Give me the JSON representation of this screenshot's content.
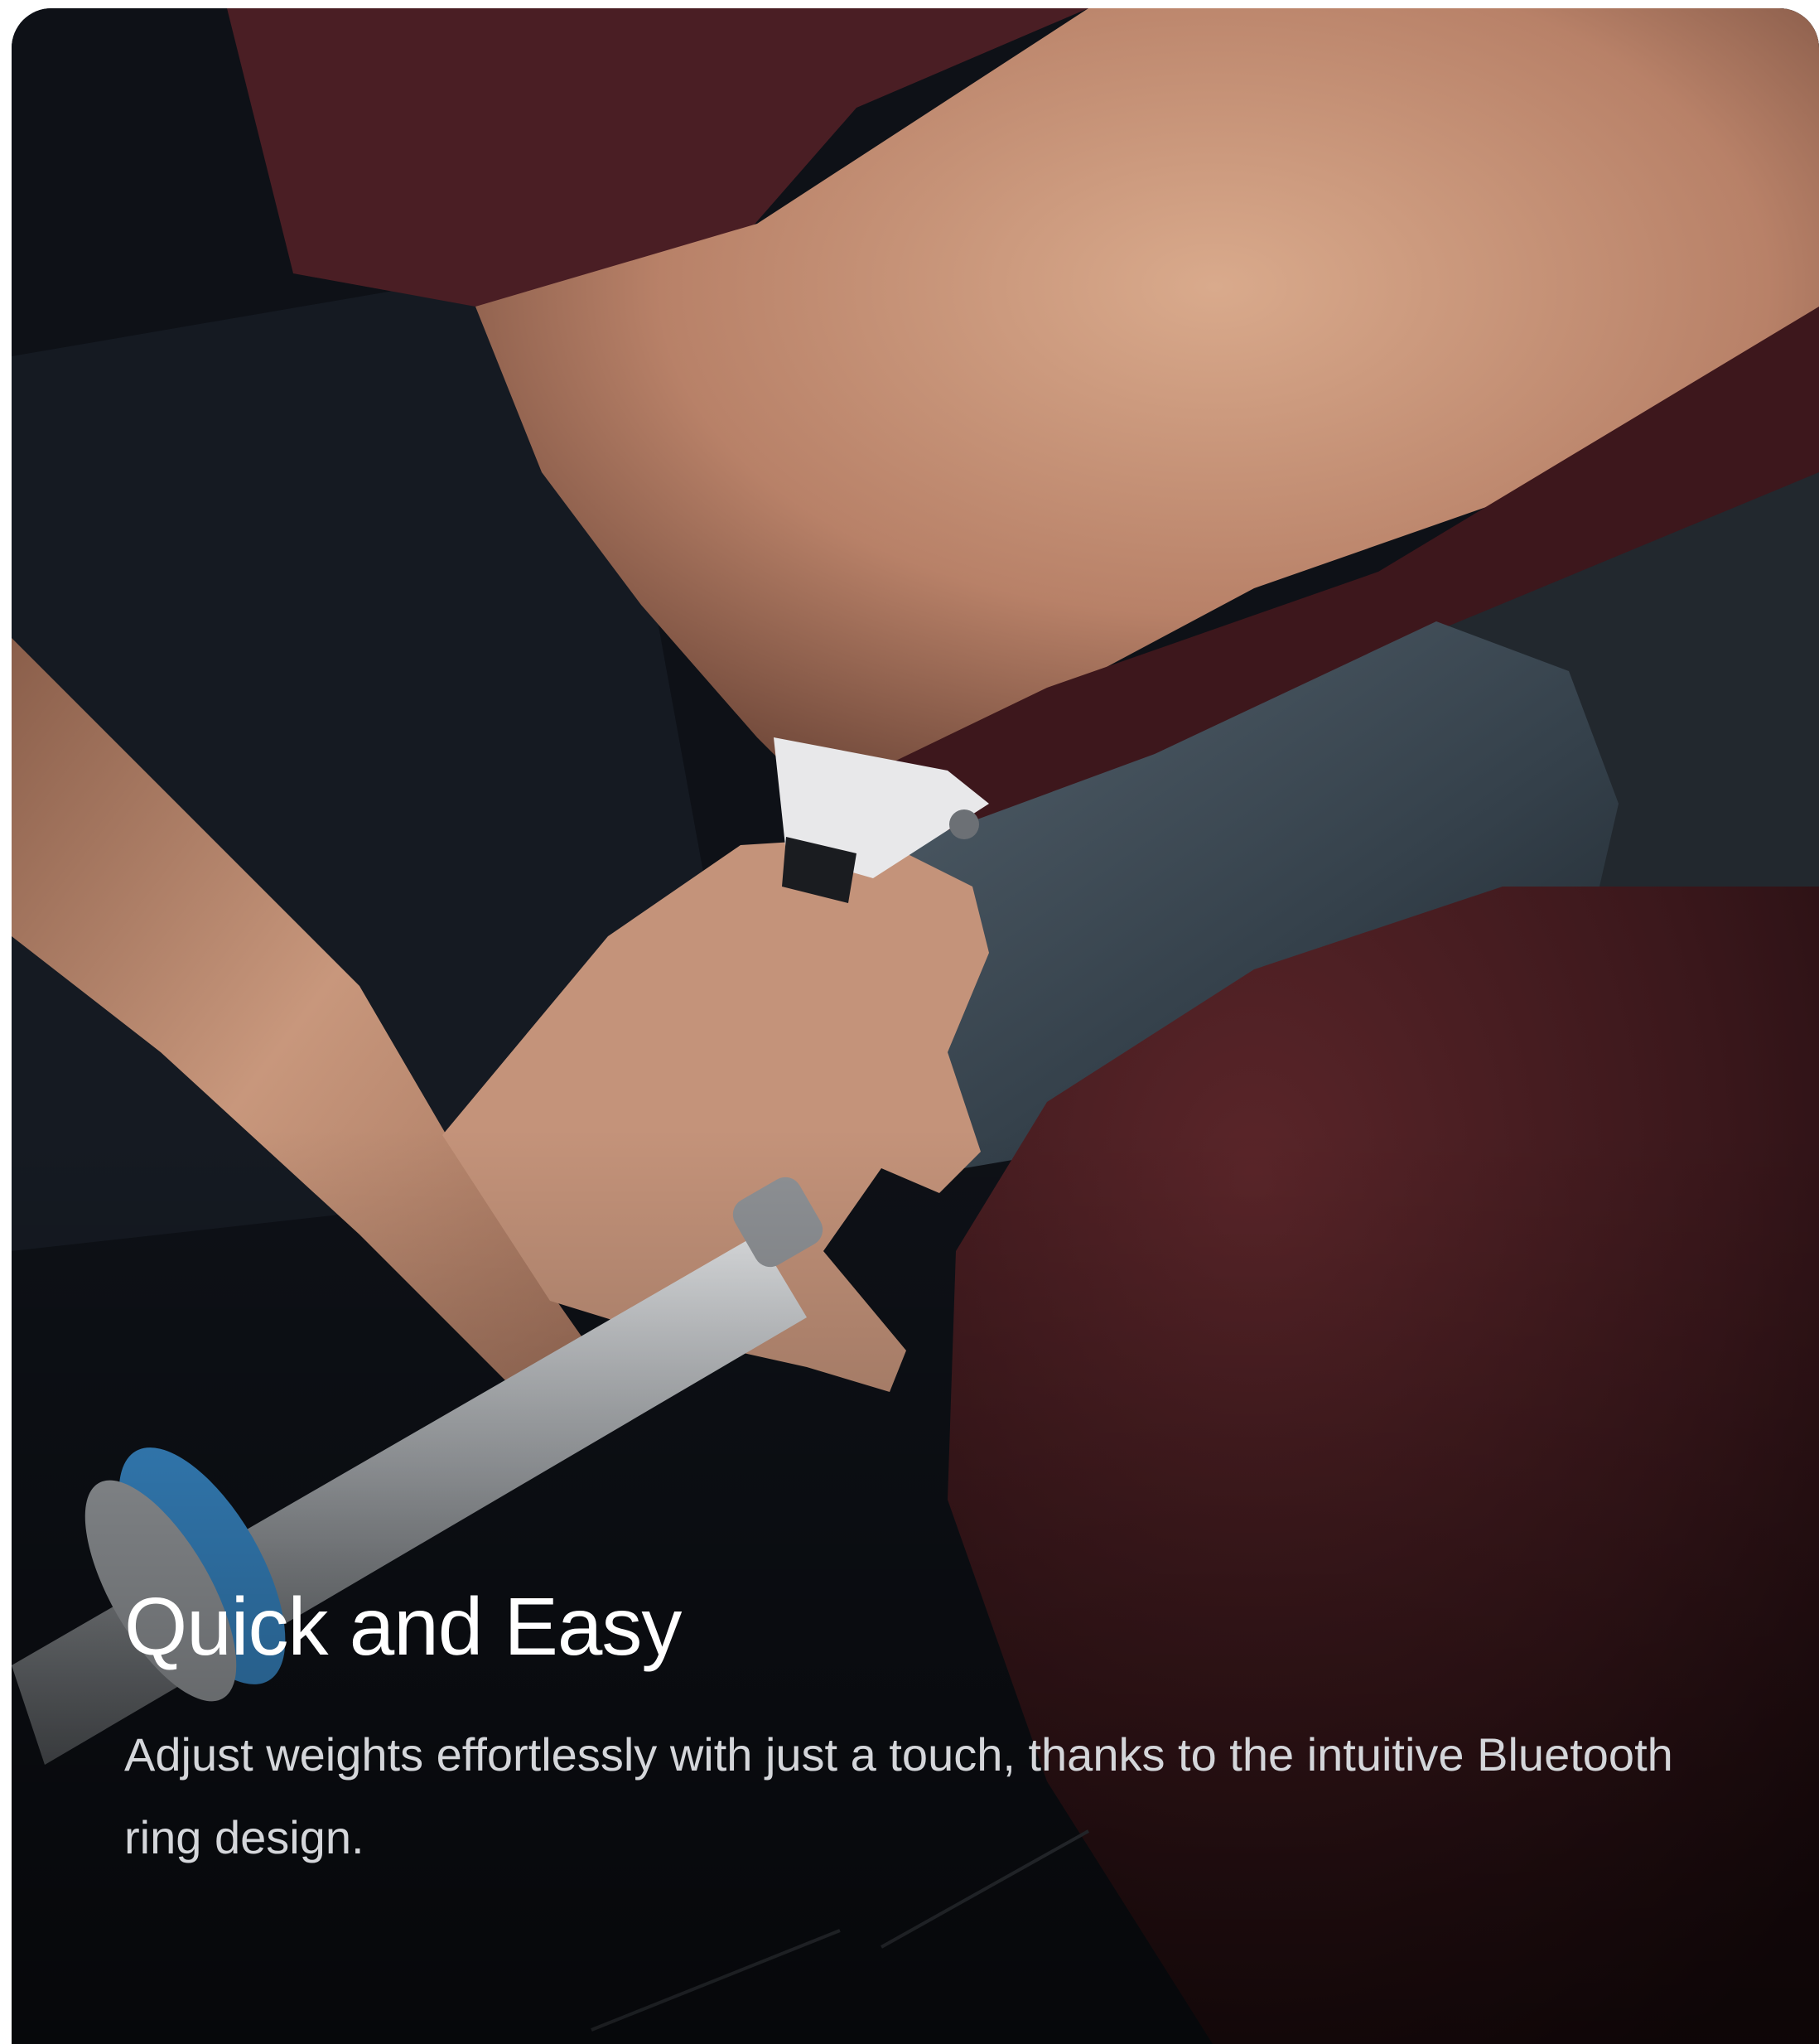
{
  "hero": {
    "title": "Quick and Easy",
    "description": "Adjust weights effortlessly with just a touch, thanks to the intuitive Bluetooth ring design."
  },
  "colors": {
    "background": "#0e1117",
    "title": "#ffffff",
    "description": "#d4d6da",
    "skin": "#c4937a",
    "maroon": "#4a1e24",
    "ring_white": "#e8e8ea",
    "pad_slate": "#3a4650",
    "bar_silver": "#b8bcc0",
    "collar_blue": "#3b8fd1"
  }
}
